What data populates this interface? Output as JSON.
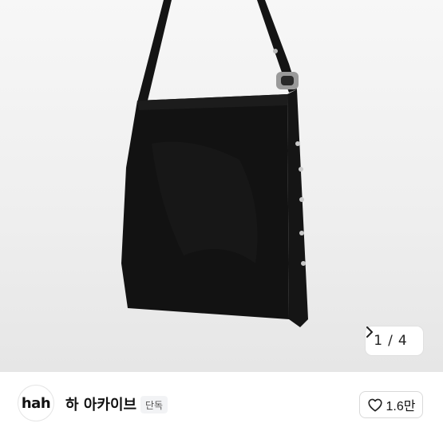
{
  "gallery": {
    "current": "1",
    "separator": "/",
    "total": "4",
    "next_icon": "chevron-right-icon"
  },
  "brand": {
    "logo_text": "hah",
    "name": "하 아카이브",
    "badge": "단독"
  },
  "like": {
    "icon": "heart-icon",
    "count": "1.6만"
  }
}
